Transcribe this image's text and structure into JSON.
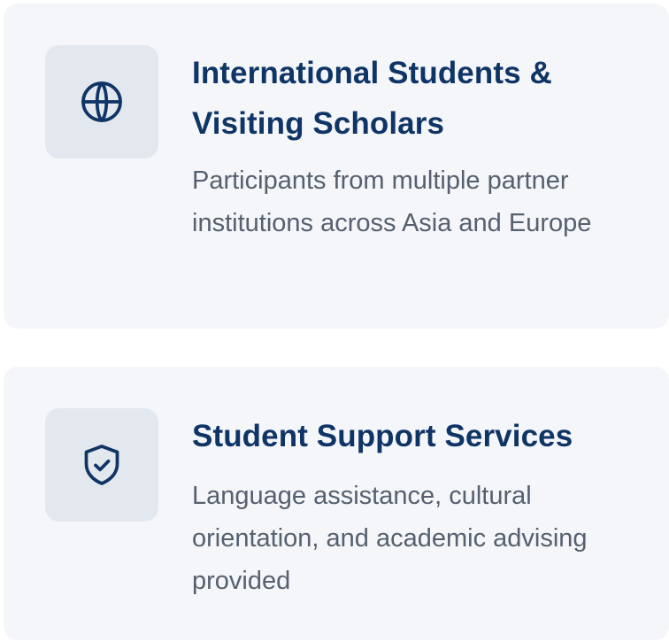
{
  "colors": {
    "card_background": "#f4f6f9",
    "icon_background": "#e3e8ef",
    "title": "#0f3466",
    "description": "#56606e",
    "icon_stroke": "#0f3466"
  },
  "cards": [
    {
      "icon": "globe-icon",
      "title": "International Students & Visiting Scholars",
      "description": "Participants from multiple partner institutions across Asia and Europe"
    },
    {
      "icon": "shield-check-icon",
      "title": "Student Support Services",
      "description": "Language assistance, cultural orientation, and academic advising provided"
    }
  ]
}
